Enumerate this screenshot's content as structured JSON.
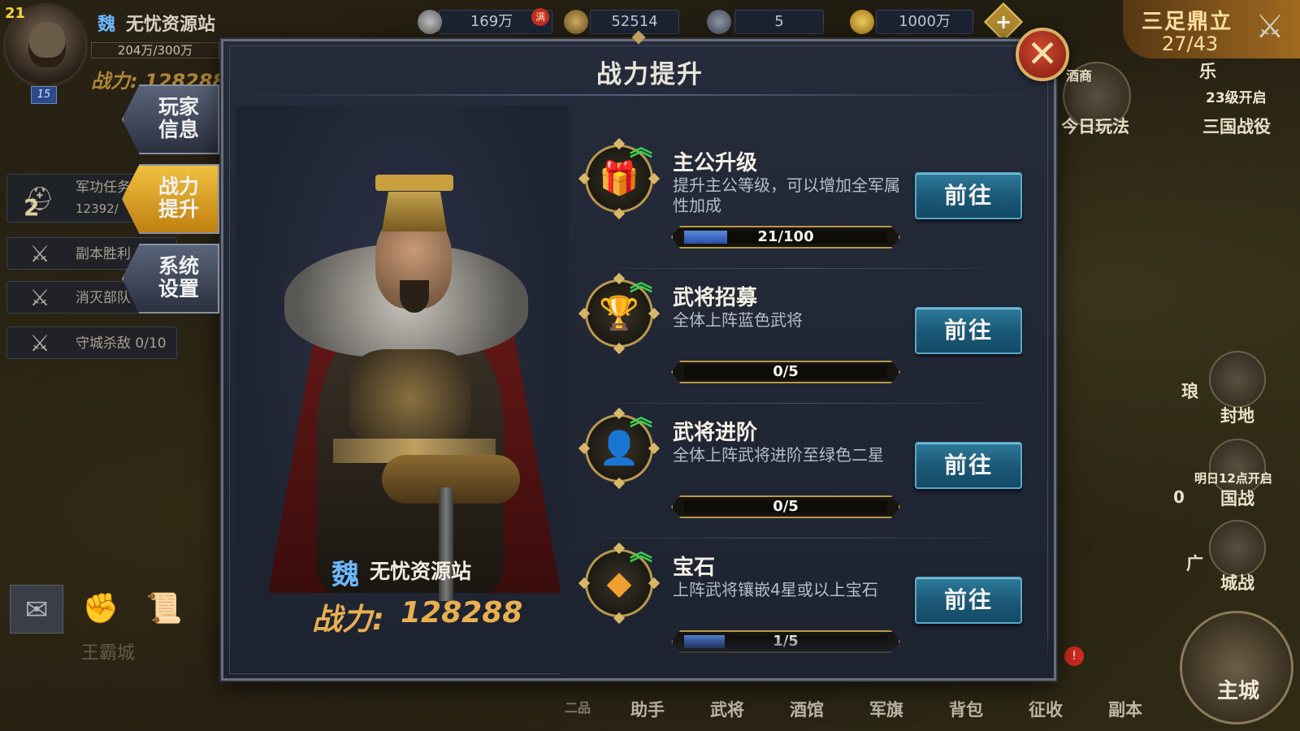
{
  "top": {
    "avatar_level": "21",
    "vip_level": "15",
    "kingdom": "魏",
    "player_name": "无忧资源站",
    "exp_text": "204万/300万",
    "power_text": "战力: 128288",
    "resources": [
      {
        "icon": "silver-coin-icon",
        "value": "169万",
        "badge": "满"
      },
      {
        "icon": "grain-icon",
        "value": "52514"
      },
      {
        "icon": "iron-icon",
        "value": "5"
      },
      {
        "icon": "gold-ingot-icon",
        "value": "1000万"
      }
    ],
    "plus_label": "+",
    "event_title": "三足鼎立",
    "event_count": "27/43"
  },
  "left_tasks": [
    {
      "icon": "helmet-icon",
      "label": "军功任务",
      "sub": "12392/",
      "num": "2"
    },
    {
      "icon": "crossed-swords-icon",
      "label": "副本胜利"
    },
    {
      "icon": "crossed-swords-icon",
      "label": "消灭部队"
    },
    {
      "icon": "crossed-swords-icon",
      "label": "守城杀敌 0/10"
    }
  ],
  "tabs": [
    {
      "label": "玩家\n信息",
      "active": false
    },
    {
      "label": "战力\n提升",
      "active": true
    },
    {
      "label": "系统\n设置",
      "active": false
    }
  ],
  "left_bottom_label": "王霸城",
  "right": {
    "tavern_label": "酒商",
    "today_label": "今日玩法",
    "level_unlock": "23级开启",
    "three_kingdoms": "三国战役",
    "le_label": "乐",
    "lang_label": "琅",
    "fief": "封地",
    "open_note": "明日12点开启",
    "national_war": "国战",
    "guang_label": "广",
    "city_war": "城战",
    "city_war_count": "0",
    "main_city": "主城"
  },
  "bottom_nav": [
    "二品",
    "助手",
    "武将",
    "酒馆",
    "军旗",
    "背包",
    "征收",
    "副本"
  ],
  "nav_badge": "!",
  "dialog": {
    "title": "战力提升",
    "close_label": "✕",
    "hero_kingdom": "魏",
    "hero_name": "无忧资源站",
    "hero_power_label": "战力:",
    "hero_power_value": "128288",
    "items": [
      {
        "icon": "token-box-icon",
        "title": "主公升级",
        "desc": "提升主公等级，可以增加全军属性加成",
        "progress_text": "21/100",
        "progress": 0.21,
        "button": "前往"
      },
      {
        "icon": "goblet-icon",
        "title": "武将招募",
        "desc": "全体上阵蓝色武将",
        "progress_text": "0/5",
        "progress": 0,
        "button": "前往"
      },
      {
        "icon": "general-portrait-icon",
        "title": "武将进阶",
        "desc": "全体上阵武将进阶至绿色二星",
        "progress_text": "0/5",
        "progress": 0,
        "button": "前往"
      },
      {
        "icon": "gem-icon",
        "title": "宝石",
        "desc": "上阵武将镶嵌4星或以上宝石",
        "progress_text": "1/5",
        "progress": 0.2,
        "button": "前往"
      }
    ]
  },
  "colors": {
    "accent_blue_button": "#1c5a78",
    "progress_fill": "#3a64c8",
    "kingdom_blue": "#6cb8ff",
    "power_gold": "#e8b050",
    "active_tab": "#e0a020",
    "up_arrow_green": "#3ad050"
  }
}
